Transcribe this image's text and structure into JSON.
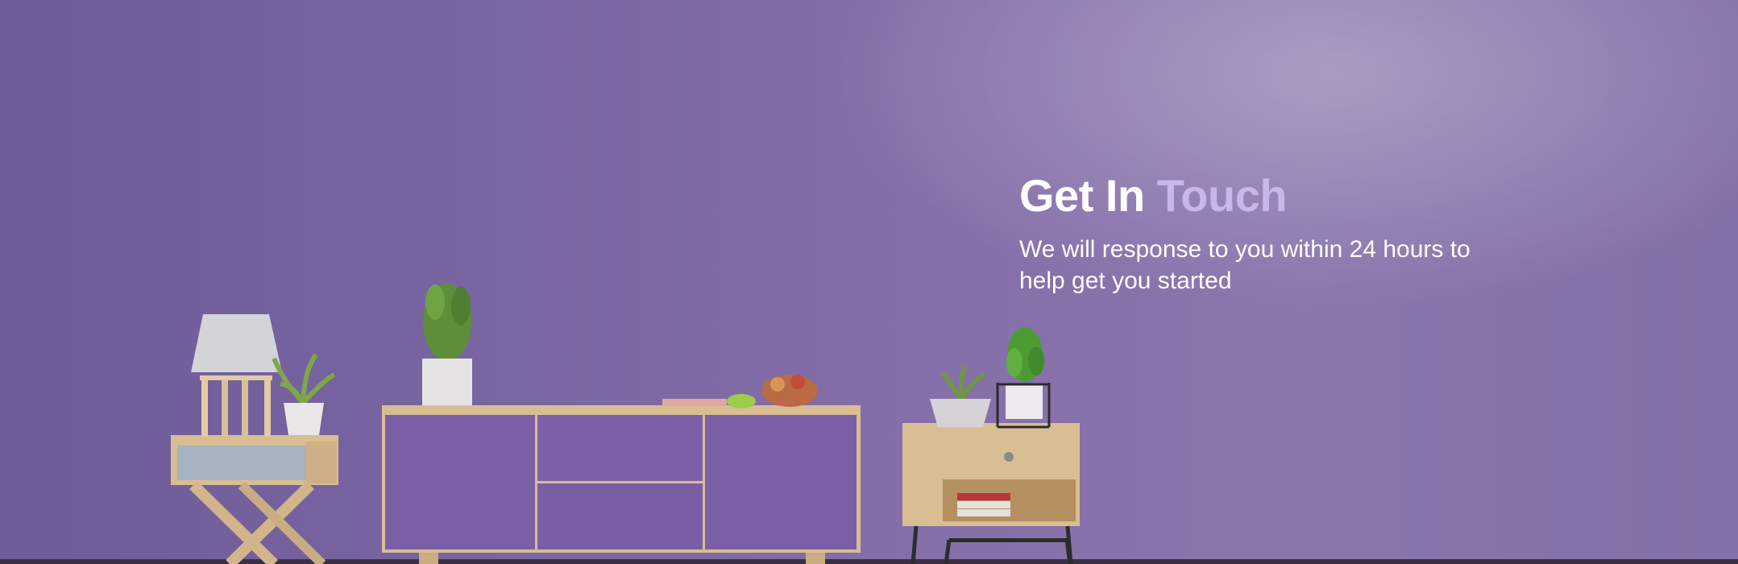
{
  "hero": {
    "title_part1": "Get In",
    "title_part2": "Touch",
    "subtitle": "We will response to you within 24 hours to help get you started"
  },
  "colors": {
    "background": "#7b66a3",
    "title": "#ffffff",
    "accent": "#c9b6ea",
    "cabinet": "#7b5fa6",
    "wood": "#d9bd93"
  },
  "illustration": {
    "items": [
      "table-lamp",
      "potted-plant",
      "side-table",
      "sideboard-cabinet",
      "fruit-bowl",
      "nightstand"
    ]
  }
}
